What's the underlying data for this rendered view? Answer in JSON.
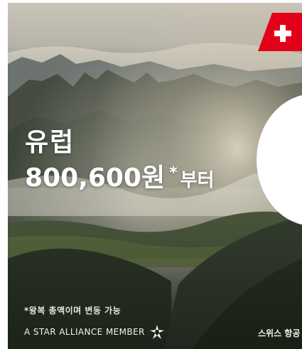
{
  "ad": {
    "region": "유럽",
    "price": "800,600원",
    "asterisk": "*",
    "price_suffix": "부터",
    "disclaimer": "*왕복 총액이며 변동 가능",
    "alliance_text": "A STAR ALLIANCE MEMBER",
    "brand_name": "스위스 항공",
    "colors": {
      "flag_red": "#e3001b",
      "flag_cross": "#ffffff",
      "text": "#ffffff"
    },
    "icons": [
      "swiss-flag-icon",
      "star-alliance-icon"
    ]
  }
}
